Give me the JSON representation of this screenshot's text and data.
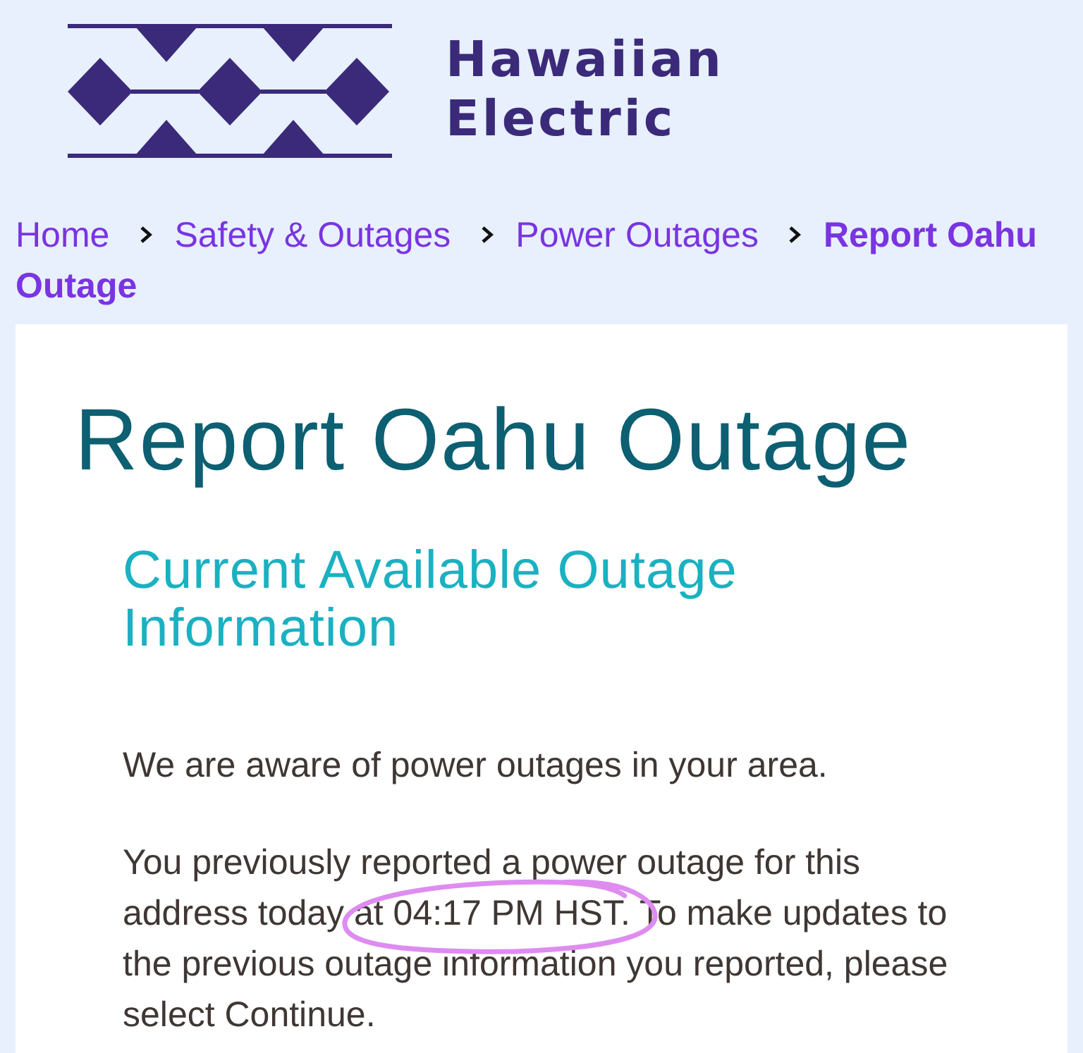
{
  "header": {
    "logo_text": "Hawaiian Electric"
  },
  "breadcrumb": [
    {
      "label": "Home",
      "current": false
    },
    {
      "label": "Safety & Outages",
      "current": false
    },
    {
      "label": "Power Outages",
      "current": false
    },
    {
      "label": "Report Oahu Outage",
      "current": true
    }
  ],
  "page": {
    "title": "Report Oahu Outage",
    "section_title": "Current Available Outage Information",
    "paragraphs": [
      {
        "segments": [
          {
            "text": "We are aware of power outages in your area.",
            "circled": false
          }
        ]
      },
      {
        "segments": [
          {
            "text": "You previously reported a power outage for this address today",
            "circled": false
          },
          {
            "text": "at 04:17 PM HST.",
            "circled": true
          },
          {
            "text": "To make updates to the previous outage information you reported, please select Continue.",
            "circled": false
          }
        ]
      }
    ]
  }
}
